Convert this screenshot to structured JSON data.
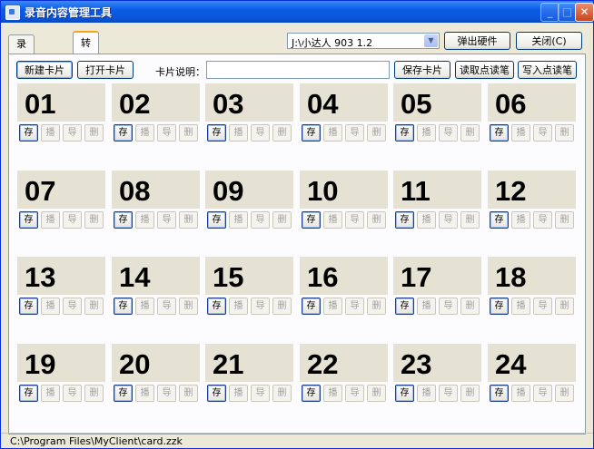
{
  "window": {
    "title": "录音内容管理工具"
  },
  "titlebar": {
    "minimize": "_",
    "maximize": "□",
    "close": "✕"
  },
  "tabs": [
    {
      "label": "录音管理"
    },
    {
      "label": "转转卡管理"
    }
  ],
  "device_select": {
    "value": "J:\\小达人 903 1.2",
    "arrow": "▼"
  },
  "buttons": {
    "eject": "弹出硬件",
    "close": "关闭(C)",
    "new_card": "新建卡片",
    "open_card": "打开卡片",
    "save_card": "保存卡片",
    "read_pen": "读取点读笔",
    "write_pen": "写入点读笔"
  },
  "card_desc": {
    "label": "卡片说明：",
    "value": ""
  },
  "card_actions": {
    "store": "存",
    "play": "播",
    "export": "导",
    "delete": "删"
  },
  "cards": [
    "01",
    "02",
    "03",
    "04",
    "05",
    "06",
    "07",
    "08",
    "09",
    "10",
    "11",
    "12",
    "13",
    "14",
    "15",
    "16",
    "17",
    "18",
    "19",
    "20",
    "21",
    "22",
    "23",
    "24"
  ],
  "statusbar": {
    "path": "C:\\Program Files\\MyClient\\card.zzk"
  }
}
